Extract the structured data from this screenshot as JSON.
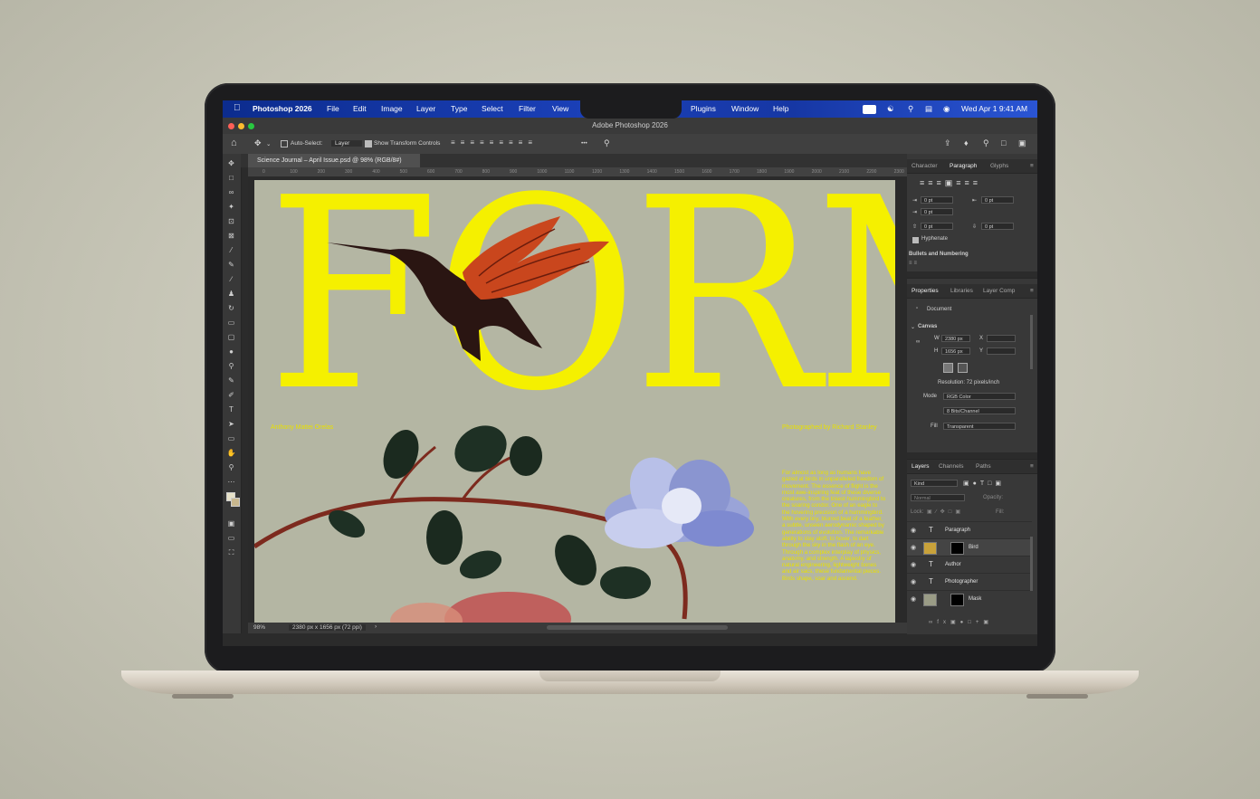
{
  "menubar": {
    "apple_icon": "apple-icon",
    "app_name": "Photoshop 2026",
    "items": [
      "File",
      "Edit",
      "Image",
      "Layer",
      "Type",
      "Select",
      "Filter",
      "View",
      "Plugins",
      "Window",
      "Help"
    ],
    "clock": "Wed Apr 1  9:41 AM"
  },
  "window": {
    "title": "Adobe Photoshop 2026"
  },
  "options_bar": {
    "auto_select_label": "Auto-Select:",
    "auto_select_value": "Layer",
    "transform_label": "Show Transform Controls",
    "more_label": "•••"
  },
  "document": {
    "tab_label": "Science Journal – April Issue.psd @ 98% (RGB/8#)",
    "zoom": "98%",
    "size_info": "2380 px x 1656 px (72 ppi)",
    "ruler_ticks": [
      "0",
      "50",
      "100",
      "150",
      "200",
      "250",
      "300",
      "350",
      "400",
      "450",
      "500",
      "550",
      "600",
      "650",
      "700",
      "750",
      "800",
      "850",
      "900",
      "950",
      "1000",
      "1050",
      "1100",
      "1150",
      "1200",
      "1250",
      "1300",
      "1350",
      "1400",
      "1450",
      "1500",
      "1550",
      "1600",
      "1650",
      "1700",
      "1750",
      "1800",
      "1850",
      "1900",
      "1950",
      "2000",
      "2050",
      "2100",
      "2150",
      "2200",
      "2250",
      "2300",
      "2350"
    ]
  },
  "artwork": {
    "headline": "FORM",
    "author_credit": "Anthony Mattei Orelas",
    "photo_credit": "Photographed by Richard Stanley",
    "body_text": "For almost as long as humans have gazed at birds in unparalleled freedom of movement. The essence of flight is the most awe-inspiring feat of these diverse creatures, from the tiniest hummingbird to the soaring condor. One of an eagle to the hovering precision of a hummingbird. With every tiny, blurred beat of a feather, a subtle, unseen aerodynamic shaped by generations of evolution. The remarkable ability to stay aloft, to hover, to dart through the sky in the flash of an eye. Through a complex interplay of physics, anatomy, and strength. A tapestry of natural engineering, lightweight bones and air sacs, these fundamental pieces. Birds shape, soar and ascend."
  },
  "paragraph_panel": {
    "tabs": [
      "Character",
      "Paragraph",
      "Glyphs"
    ],
    "active_tab": "Paragraph",
    "indent_left": "0 pt",
    "indent_right": "0 pt",
    "indent_first": "0 pt",
    "space_before": "0 pt",
    "space_after": "0 pt",
    "hyphenate_label": "Hyphenate",
    "bullets_label": "Bullets and Numbering"
  },
  "properties_panel": {
    "tabs": [
      "Properties",
      "Libraries",
      "Layer Comp"
    ],
    "active_tab": "Properties",
    "document_label": "Document",
    "canvas_label": "Canvas",
    "width_label": "W",
    "width_value": "2380 px",
    "height_label": "H",
    "height_value": "1656 px",
    "x_label": "X",
    "y_label": "Y",
    "resolution": "Resolution: 72 pixels/inch",
    "mode_label": "Mode",
    "mode_value": "RGB Color",
    "depth_value": "8 Bits/Channel",
    "fill_label": "Fill",
    "fill_value": "Transparent"
  },
  "layers_panel": {
    "tabs": [
      "Layers",
      "Channels",
      "Paths"
    ],
    "active_tab": "Layers",
    "filter_value": "Kind",
    "blend_value": "Normal",
    "opacity_label": "Opacity:",
    "lock_label": "Lock:",
    "fill_label": "Fill:",
    "layers": [
      {
        "name": "Paragraph",
        "kind": "text"
      },
      {
        "name": "Bird",
        "kind": "image"
      },
      {
        "name": "Author",
        "kind": "text"
      },
      {
        "name": "Photographer",
        "kind": "text"
      },
      {
        "name": "Mask",
        "kind": "image"
      }
    ]
  },
  "colors": {
    "headline_yellow": "#f5f000",
    "artboard_bg": "#b4b6a3",
    "menubar_blue": "#1b40b8",
    "ui_dark": "#383838"
  }
}
